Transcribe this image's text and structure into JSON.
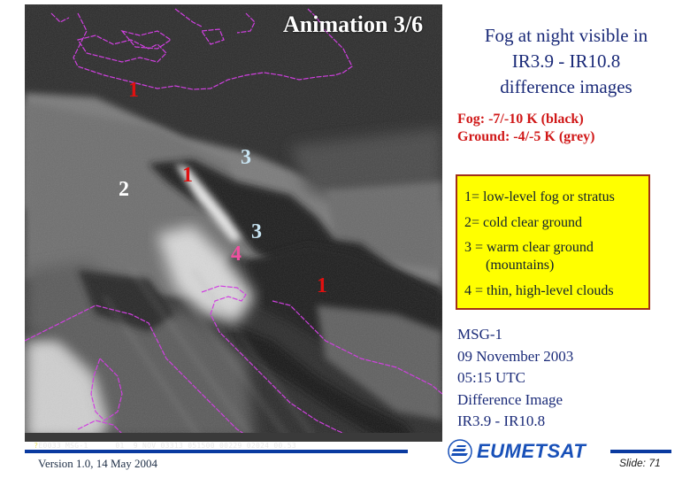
{
  "image": {
    "animation_label": "Animation 3/6",
    "labels": [
      {
        "text": "1",
        "color_role": "red"
      },
      {
        "text": "1",
        "color_role": "red"
      },
      {
        "text": "1",
        "color_role": "red"
      },
      {
        "text": "2",
        "color_role": "white"
      },
      {
        "text": "3",
        "color_role": "lightblue"
      },
      {
        "text": "3",
        "color_role": "lightblue"
      },
      {
        "text": "4",
        "color_role": "pink"
      }
    ],
    "info_strip": {
      "first": "?",
      "rest": "E0033 MSG-1      01  9 NOV 03313 051500 00229 02024 00.53"
    },
    "coastline_color": "#d040e0"
  },
  "heading": {
    "lines": [
      "Fog at night visible in",
      "IR3.9 - IR10.8",
      "difference images"
    ]
  },
  "temperatures": {
    "fog": "Fog: -7/-10 K (black)",
    "ground": "Ground: -4/-5 K (grey)"
  },
  "legend": {
    "items": [
      "1= low-level fog or stratus",
      "2= cold clear ground",
      "3 = warm clear ground",
      "(mountains)",
      "4 = thin, high-level clouds"
    ],
    "background": "#ffff00",
    "border": "#a03018"
  },
  "info": {
    "lines": [
      "MSG-1",
      "09 November 2003",
      "05:15 UTC",
      "Difference Image",
      "IR3.9 - IR10.8"
    ]
  },
  "footer": {
    "version": "Version 1.0, 14 May 2004",
    "logo_text": "EUMETSAT",
    "slide": "Slide: 71"
  },
  "colors": {
    "heading_blue": "#1a2a78",
    "accent_red": "#d01818",
    "rule_blue": "#0a3aa0"
  }
}
